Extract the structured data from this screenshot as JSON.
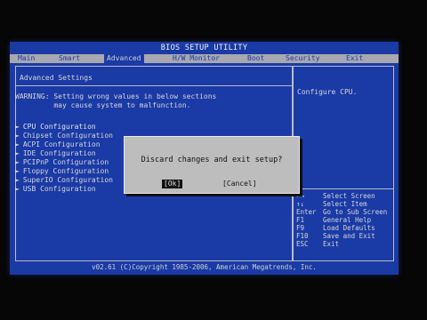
{
  "header": {
    "title": "BIOS SETUP UTILITY",
    "tabs": [
      {
        "label": "Main"
      },
      {
        "label": "Smart"
      },
      {
        "label": "Advanced"
      },
      {
        "label": "H/W Monitor"
      },
      {
        "label": "Boot"
      },
      {
        "label": "Security"
      },
      {
        "label": "Exit"
      }
    ]
  },
  "main": {
    "section_title": "Advanced Settings",
    "warning_line1": "WARNING: Setting wrong values in below sections",
    "warning_line2": "         may cause system to malfunction.",
    "items": [
      {
        "label": "CPU Configuration"
      },
      {
        "label": "Chipset Configuration"
      },
      {
        "label": "ACPI Configuration"
      },
      {
        "label": "IDE Configuration"
      },
      {
        "label": "PCIPnP Configuration"
      },
      {
        "label": "Floppy Configuration"
      },
      {
        "label": "SuperIO Configuration"
      },
      {
        "label": "USB Configuration"
      }
    ]
  },
  "help": {
    "text": "Configure CPU.",
    "keys": [
      {
        "key": "←→",
        "desc": "Select Screen"
      },
      {
        "key": "↑↓",
        "desc": "Select Item"
      },
      {
        "key": "Enter",
        "desc": "Go to Sub Screen"
      },
      {
        "key": "F1",
        "desc": "General Help"
      },
      {
        "key": "F9",
        "desc": "Load Defaults"
      },
      {
        "key": "F10",
        "desc": "Save and Exit"
      },
      {
        "key": "ESC",
        "desc": "Exit"
      }
    ]
  },
  "footer": {
    "copyright": "v02.61 (C)Copyright 1985-2006, American Megatrends, Inc."
  },
  "dialog": {
    "message": "Discard changes and exit setup?",
    "ok_label": "[Ok]",
    "cancel_label": "[Cancel]"
  },
  "colors": {
    "background": "#1a3aa6",
    "bar": "#a8a8b0",
    "dialog": "#bdbdbd"
  }
}
